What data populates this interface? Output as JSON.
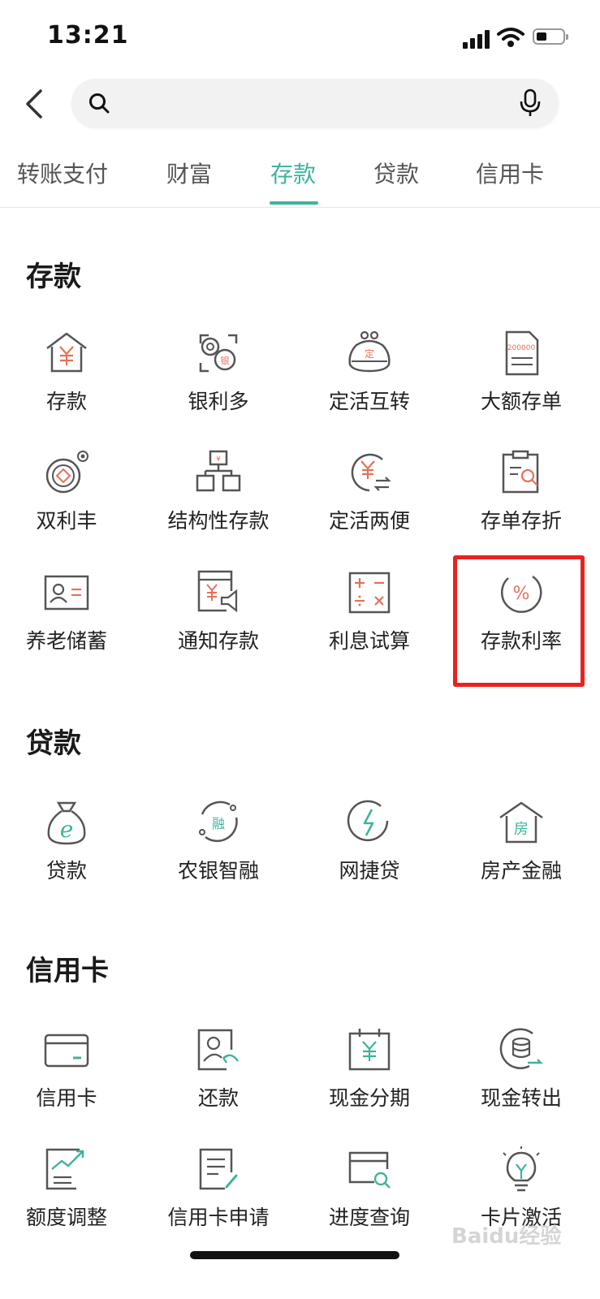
{
  "status_bar": {
    "time": "13:21"
  },
  "search": {
    "placeholder": ""
  },
  "tabs": [
    {
      "label": "转账支付",
      "active": false
    },
    {
      "label": "财富",
      "active": false
    },
    {
      "label": "存款",
      "active": true
    },
    {
      "label": "贷款",
      "active": false
    },
    {
      "label": "信用卡",
      "active": false
    }
  ],
  "sections": {
    "deposit": {
      "title": "存款",
      "items": [
        {
          "label": "存款",
          "icon": "house-yuan-icon"
        },
        {
          "label": "银利多",
          "icon": "coins-silver-icon"
        },
        {
          "label": "定活互转",
          "icon": "purse-fixed-icon"
        },
        {
          "label": "大额存单",
          "icon": "certificate-200000-icon"
        },
        {
          "label": "双利丰",
          "icon": "double-coin-icon"
        },
        {
          "label": "结构性存款",
          "icon": "structure-blocks-icon"
        },
        {
          "label": "定活两便",
          "icon": "yuan-exchange-icon"
        },
        {
          "label": "存单存折",
          "icon": "clipboard-search-icon"
        },
        {
          "label": "养老储蓄",
          "icon": "id-card-icon"
        },
        {
          "label": "通知存款",
          "icon": "notice-megaphone-icon"
        },
        {
          "label": "利息试算",
          "icon": "calculator-icon"
        },
        {
          "label": "存款利率",
          "icon": "percent-circle-icon"
        }
      ]
    },
    "loan": {
      "title": "贷款",
      "items": [
        {
          "label": "贷款",
          "icon": "money-bag-icon"
        },
        {
          "label": "农银智融",
          "icon": "rong-circle-icon"
        },
        {
          "label": "网捷贷",
          "icon": "lightning-circle-icon"
        },
        {
          "label": "房产金融",
          "icon": "house-fang-icon"
        }
      ]
    },
    "credit": {
      "title": "信用卡",
      "items": [
        {
          "label": "信用卡",
          "icon": "credit-card-icon"
        },
        {
          "label": "还款",
          "icon": "repay-person-icon"
        },
        {
          "label": "现金分期",
          "icon": "calendar-yuan-icon"
        },
        {
          "label": "现金转出",
          "icon": "coin-stack-out-icon"
        },
        {
          "label": "额度调整",
          "icon": "chart-up-icon"
        },
        {
          "label": "信用卡申请",
          "icon": "document-pen-icon"
        },
        {
          "label": "进度查询",
          "icon": "card-search-icon"
        },
        {
          "label": "卡片激活",
          "icon": "lightbulb-icon"
        }
      ]
    }
  },
  "colors": {
    "accent": "#3fb39c",
    "icon_line": "#555555",
    "icon_red": "#e2725b",
    "highlight": "#e8231f"
  },
  "watermark": "Baidu经验"
}
